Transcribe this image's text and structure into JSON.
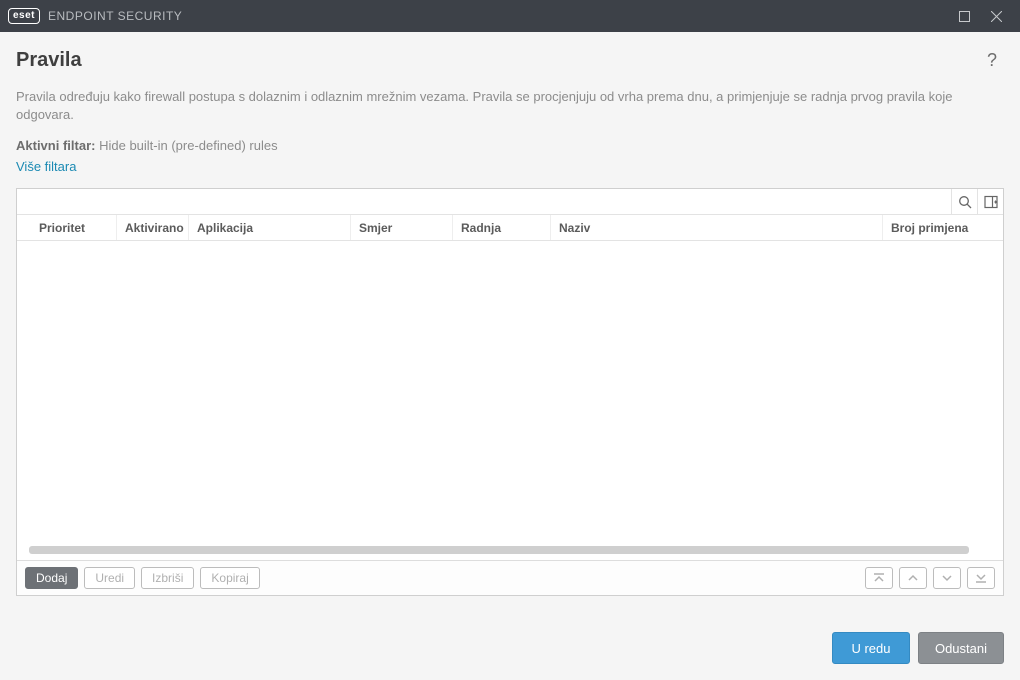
{
  "titlebar": {
    "brand": "eset",
    "title": "ENDPOINT SECURITY"
  },
  "page": {
    "title": "Pravila",
    "description": "Pravila određuju kako firewall postupa s dolaznim i odlaznim mrežnim vezama. Pravila se procjenjuju od vrha prema dnu, a primjenjuje se radnja prvog pravila koje odgovara.",
    "filter_label": "Aktivni filtar:",
    "filter_value": "Hide built-in (pre-defined) rules",
    "more_filters": "Više filtara"
  },
  "table": {
    "columns": {
      "priority": "Prioritet",
      "activated": "Aktivirano",
      "app": "Aplikacija",
      "direction": "Smjer",
      "action": "Radnja",
      "name": "Naziv",
      "count": "Broj primjena"
    },
    "rows": []
  },
  "actions": {
    "add": "Dodaj",
    "edit": "Uredi",
    "delete": "Izbriši",
    "copy": "Kopiraj"
  },
  "footer": {
    "ok": "U redu",
    "cancel": "Odustani"
  }
}
